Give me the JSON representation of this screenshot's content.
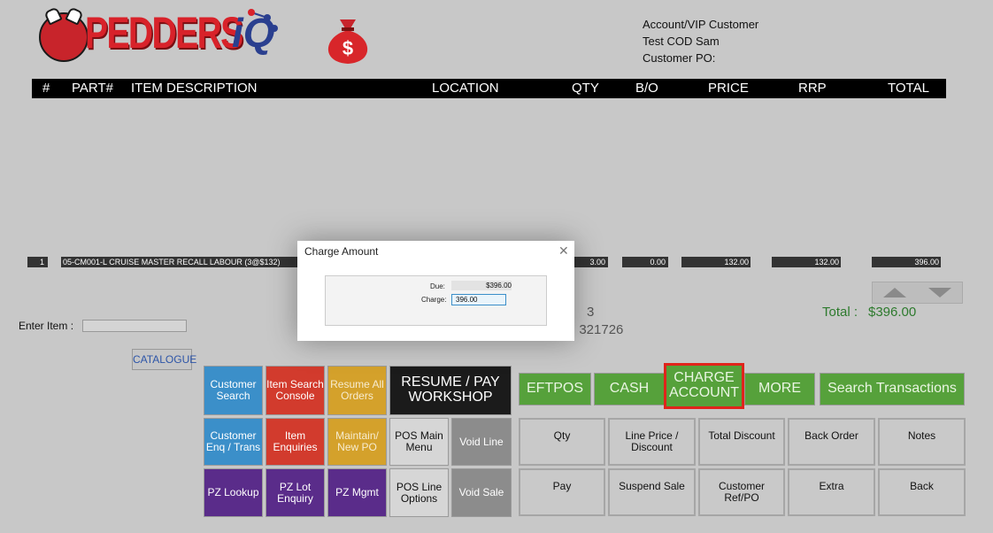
{
  "header": {
    "brand": "PEDDERS",
    "brand_suffix": "iQ",
    "customer_type": "Account/VIP Customer",
    "customer_name": "Test COD Sam",
    "customer_po": "Customer PO:"
  },
  "table": {
    "columns": [
      "#",
      "PART#",
      "ITEM DESCRIPTION",
      "LOCATION",
      "QTY",
      "B/O",
      "PRICE",
      "RRP",
      "TOTAL"
    ],
    "rows": [
      {
        "num": "1",
        "description": "05-CM001-L CRUISE MASTER RECALL LABOUR  (3@$132)",
        "qty": "3.00",
        "bo": "0.00",
        "price": "132.00",
        "rrp": "132.00",
        "total": "396.00"
      }
    ]
  },
  "summary": {
    "partial1": "3",
    "partial2": ": 321726",
    "total_label": "Total :",
    "total_value": "$396.00"
  },
  "entry": {
    "label": "Enter Item :",
    "catalogue": "CATALOGUE"
  },
  "left_buttons": {
    "customer_search": "Customer Search",
    "item_search_console": "Item Search Console",
    "resume_all_orders": "Resume All Orders",
    "resume_pay_workshop": "RESUME / PAY WORKSHOP",
    "customer_enq": "Customer Enq / Trans",
    "item_enquiries": "Item Enquiries",
    "maintain_new_po": "Maintain/ New PO",
    "pos_main_menu": "POS Main Menu",
    "void_line": "Void Line",
    "pz_lookup": "PZ Lookup",
    "pz_lot_enquiry": "PZ Lot Enquiry",
    "pz_mgmt": "PZ Mgmt",
    "pos_line_options": "POS Line Options",
    "void_sale": "Void Sale"
  },
  "pay_buttons": {
    "eftpos": "EFTPOS",
    "cash": "CASH",
    "charge_account": "CHARGE ACCOUNT",
    "more": "MORE",
    "search_transactions": "Search Transactions"
  },
  "action_buttons": {
    "qty": "Qty",
    "line_price": "Line Price / Discount",
    "total_discount": "Total Discount",
    "back_order": "Back Order",
    "notes": "Notes",
    "pay": "Pay",
    "suspend_sale": "Suspend Sale",
    "customer_ref": "Customer Ref/PO",
    "extra": "Extra",
    "back": "Back"
  },
  "modal": {
    "title": "Charge Amount",
    "due_label": "Due:",
    "due_value": "$396.00",
    "charge_label": "Charge:",
    "charge_value": "396.00"
  },
  "colors": {
    "accent_green": "#56a13b",
    "highlight_red": "#e0241b",
    "brand_red": "#d8222a",
    "brand_blue": "#2a3f8f"
  }
}
